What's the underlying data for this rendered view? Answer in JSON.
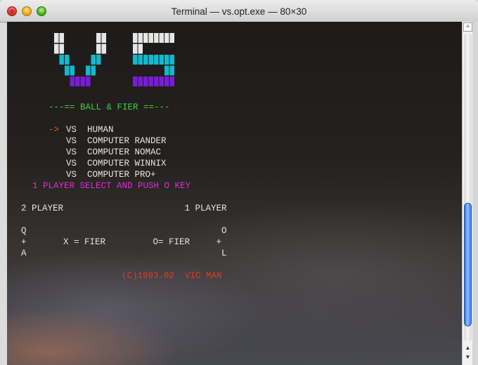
{
  "window": {
    "title": "Terminal — vs.opt.exe — 80×30"
  },
  "logo": {
    "text": "VS",
    "colors": {
      "top": "#e6e6e6",
      "middle": "#11b9cf",
      "bottom": "#7a1cd6"
    }
  },
  "terminal": {
    "subtitle": "---== BALL & FIER ==---",
    "cursor": "->",
    "menu": [
      "VS  HUMAN",
      "VS  COMPUTER RANDER",
      "VS  COMPUTER NOMAC",
      "VS  COMPUTER WINNIX",
      "VS  COMPUTER PRO+"
    ],
    "prompt": "1 PLAYER SELECT AND PUSH O KEY",
    "players_line": "2 PLAYER                       1 PLAYER",
    "controls_1": "Q                                     O",
    "controls_2": "+       X = FIER         O= FIER     +",
    "controls_3": "A                                     L",
    "copyright": "(C)1993.02  VIC MAN"
  },
  "scrollbar": {
    "up_icon": "▲",
    "down_icon": "▼",
    "resize_icon": "≡"
  }
}
